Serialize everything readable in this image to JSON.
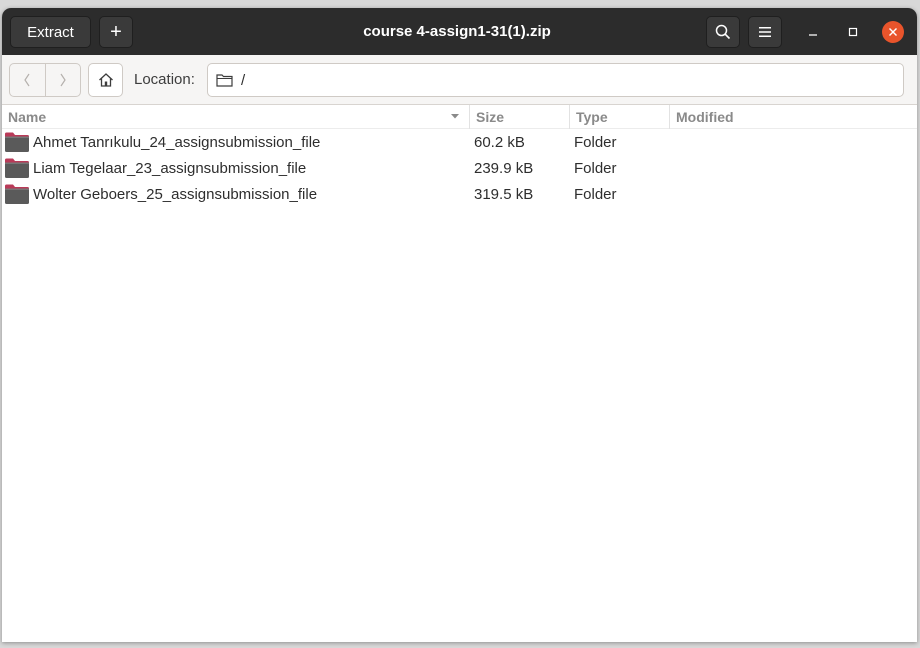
{
  "header": {
    "extract_label": "Extract",
    "new_label": "+",
    "title": "course 4-assign1-31(1).zip"
  },
  "toolbar": {
    "location_label": "Location:",
    "location_path": "/"
  },
  "columns": {
    "name": "Name",
    "size": "Size",
    "type": "Type",
    "modified": "Modified"
  },
  "files": [
    {
      "name": "Ahmet Tanrıkulu_24_assignsubmission_file",
      "size": "60.2 kB",
      "type": "Folder",
      "modified": "",
      "icon": "folder-icon"
    },
    {
      "name": "Liam Tegelaar_23_assignsubmission_file",
      "size": "239.9 kB",
      "type": "Folder",
      "modified": "",
      "icon": "folder-icon"
    },
    {
      "name": "Wolter Geboers_25_assignsubmission_file",
      "size": "319.5 kB",
      "type": "Folder",
      "modified": "",
      "icon": "folder-icon"
    }
  ],
  "colors": {
    "headerbar": "#2c2c2c",
    "close_button": "#e9542b",
    "folder": "#5a5a5a",
    "folder_accent": "#b93a58"
  }
}
